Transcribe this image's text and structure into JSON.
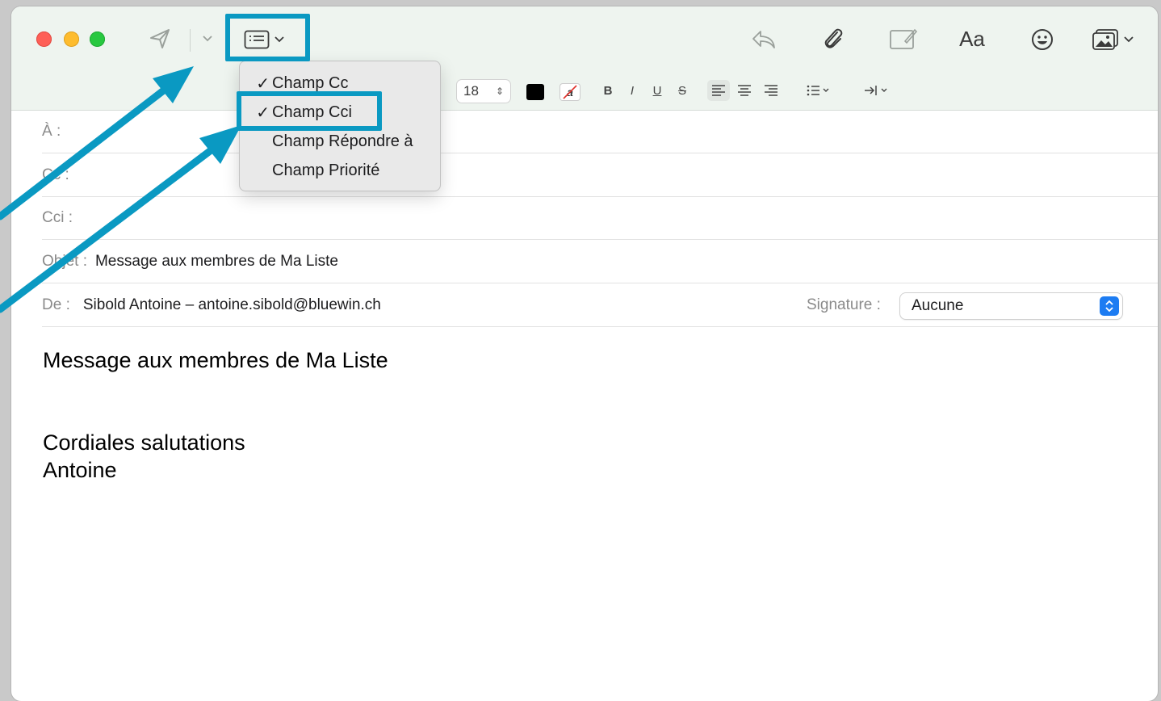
{
  "toolbar": {
    "send_icon": "paper-plane-icon",
    "header_fields_icon": "list-header-fields-icon",
    "reply_icon": "reply-arrow-icon",
    "attach_icon": "paperclip-icon",
    "markup_icon": "markup-icon",
    "format_label": "Aa",
    "emoji_icon": "smiley-icon",
    "photo_icon": "photo-browser-icon"
  },
  "format_bar": {
    "font_size": "18",
    "font_color": "#000000",
    "bold": "B",
    "italic": "I",
    "underline": "U",
    "strike": "S"
  },
  "header_fields_menu": {
    "items": [
      {
        "label": "Champ Cc",
        "checked": "✓"
      },
      {
        "label": "Champ Cci",
        "checked": "✓"
      },
      {
        "label": "Champ Répondre à",
        "checked": ""
      },
      {
        "label": "Champ Priorité",
        "checked": ""
      }
    ]
  },
  "headers": {
    "to_label": "À :",
    "cc_label": "Cc :",
    "bcc_label": "Cci :",
    "subject_label": "Objet :",
    "subject_value": "Message aux membres de Ma Liste",
    "from_label": "De :",
    "from_value": "Sibold Antoine – antoine.sibold@bluewin.ch",
    "signature_label": "Signature :",
    "signature_value": "Aucune"
  },
  "message_body": {
    "line1": "Message aux membres de Ma Liste",
    "line2": "Cordiales salutations",
    "line3": "Antoine"
  },
  "annotation_color": "#0a99c2"
}
